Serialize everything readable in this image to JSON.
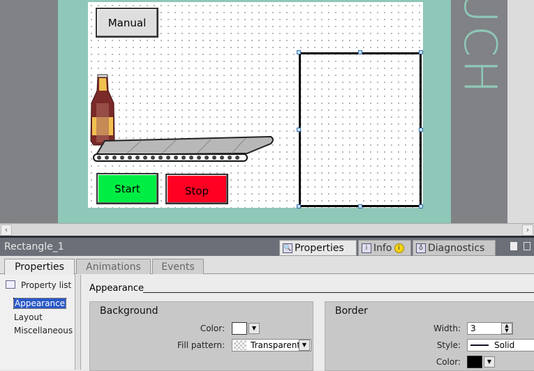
{
  "hmi": {
    "manual_label": "Manual",
    "start_label": "Start",
    "stop_label": "Stop",
    "brand_text": "UCH",
    "colors": {
      "start": "#00ee44",
      "stop": "#ff0022",
      "teal": "#8fc8b8"
    }
  },
  "inspector": {
    "title": "Rectangle_1",
    "tabs": [
      {
        "label": "Properties",
        "icon": "magnifier-icon",
        "active": true
      },
      {
        "label": "Info",
        "icon": "info-icon"
      },
      {
        "label": "Diagnostics",
        "icon": "diagnostics-icon"
      }
    ],
    "subtabs": [
      "Properties",
      "Animations",
      "Events"
    ],
    "property_list_label": "Property list",
    "side_items": [
      "Appearance",
      "Layout",
      "Miscellaneous"
    ],
    "section_title": "Appearance",
    "background": {
      "title": "Background",
      "color_label": "Color:",
      "color_value": "#ffffff",
      "fill_label": "Fill pattern:",
      "fill_value": "Transparent"
    },
    "border": {
      "title": "Border",
      "width_label": "Width:",
      "width_value": "3",
      "style_label": "Style:",
      "style_value": "Solid",
      "color_label": "Color:",
      "color_value": "#000000"
    }
  }
}
